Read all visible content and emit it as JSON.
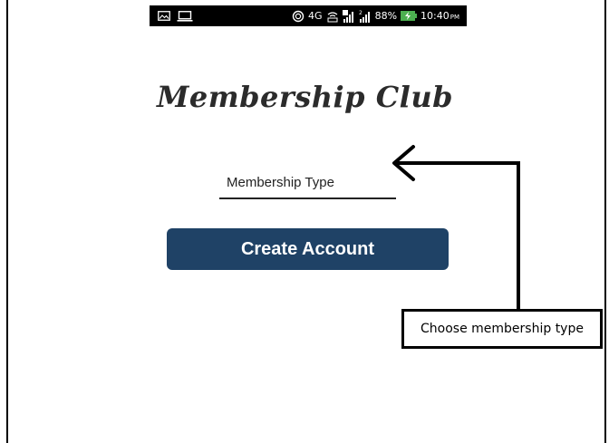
{
  "status_bar": {
    "network_label": "4G",
    "battery_percent": "88%",
    "time": "10:40",
    "time_suffix": "PM",
    "icons": [
      "image-icon",
      "laptop-icon",
      "wifi-icon",
      "volte-icon",
      "signal-icon",
      "signal-2-icon",
      "battery-charging-icon"
    ]
  },
  "app": {
    "title": "Membership Club"
  },
  "form": {
    "membership_type_placeholder": "Membership Type",
    "membership_type_value": "",
    "create_account_label": "Create Account"
  },
  "annotation": {
    "text": "Choose membership type"
  },
  "colors": {
    "button_bg": "#1f4266",
    "button_text": "#ffffff",
    "status_bar_bg": "#000000",
    "battery_fill": "#4caf50"
  }
}
